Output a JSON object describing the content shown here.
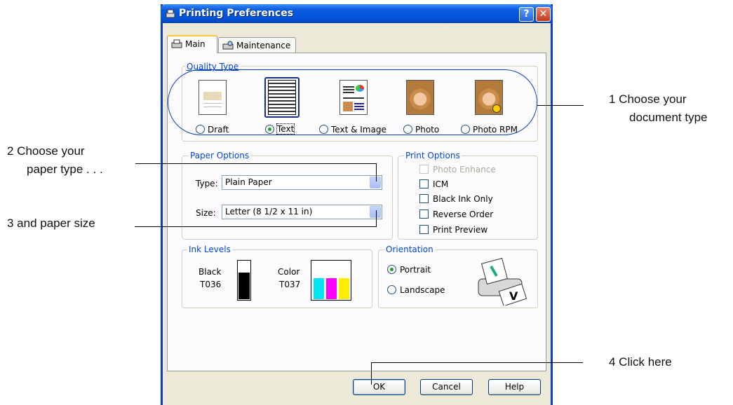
{
  "window": {
    "title": "Printing Preferences",
    "help_button": "?",
    "close_button": "✕"
  },
  "tabs": [
    {
      "label": "Main"
    },
    {
      "label": "Maintenance"
    }
  ],
  "quality_type": {
    "label": "Quality Type",
    "options": [
      {
        "label": "Draft",
        "selected": false,
        "icon": "draft-document-icon"
      },
      {
        "label": "Text",
        "selected": true,
        "icon": "text-document-icon"
      },
      {
        "label": "Text & Image",
        "selected": false,
        "icon": "text-image-document-icon"
      },
      {
        "label": "Photo",
        "selected": false,
        "icon": "photo-document-icon"
      },
      {
        "label": "Photo RPM",
        "selected": false,
        "icon": "photo-rpm-document-icon"
      }
    ]
  },
  "paper_options": {
    "label": "Paper Options",
    "type_label": "Type:",
    "type_value": "Plain Paper",
    "size_label": "Size:",
    "size_value": "Letter (8 1/2 x 11 in)"
  },
  "print_options": {
    "label": "Print Options",
    "items": [
      {
        "label": "Photo Enhance",
        "checked": false,
        "disabled": true
      },
      {
        "label": "ICM",
        "checked": false,
        "disabled": false
      },
      {
        "label": "Black Ink Only",
        "checked": false,
        "disabled": false
      },
      {
        "label": "Reverse Order",
        "checked": false,
        "disabled": false
      },
      {
        "label": "Print Preview",
        "checked": false,
        "disabled": false
      }
    ]
  },
  "ink_levels": {
    "label": "Ink Levels",
    "black": {
      "name": "Black",
      "code": "T036",
      "level": 0.7
    },
    "color": {
      "name": "Color",
      "code": "T037",
      "levels": {
        "cyan": 0.55,
        "magenta": 0.55,
        "yellow": 0.55
      }
    }
  },
  "orientation": {
    "label": "Orientation",
    "options": [
      {
        "label": "Portrait",
        "selected": true
      },
      {
        "label": "Landscape",
        "selected": false
      }
    ]
  },
  "buttons": {
    "ok": "OK",
    "cancel": "Cancel",
    "help": "Help"
  },
  "callouts": {
    "c1_line1": "1   Choose your",
    "c1_line2": "document type",
    "c2_line1": "2   Choose your",
    "c2_line2": "paper type . . .",
    "c3": "3   and paper size",
    "c4": "4   Click here"
  },
  "colors": {
    "accent": "#0046d5",
    "titlebar": "#0454d8",
    "cyan": "#00e5f5",
    "magenta": "#ff00ff",
    "yellow": "#ffee00"
  }
}
